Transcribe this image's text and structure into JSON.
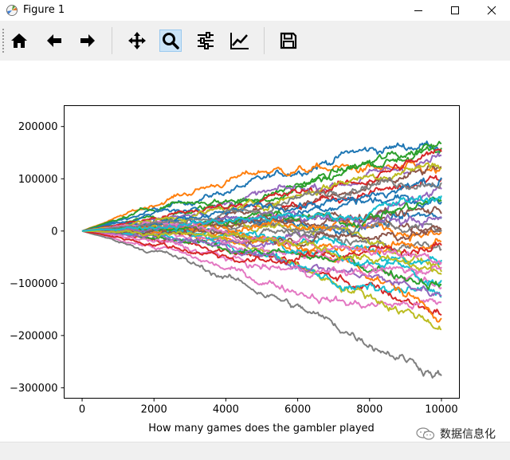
{
  "window": {
    "title": "Figure 1",
    "app_icon": "matplotlib-icon",
    "controls": [
      "minimize-icon",
      "maximize-icon",
      "close-icon"
    ]
  },
  "toolbar": {
    "buttons": [
      {
        "name": "home",
        "icon": "home-icon"
      },
      {
        "name": "back",
        "icon": "arrow-left-icon"
      },
      {
        "name": "forward",
        "icon": "arrow-right-icon"
      },
      {
        "name": "pan",
        "icon": "move-icon"
      },
      {
        "name": "zoom",
        "icon": "magnifier-icon",
        "active": true
      },
      {
        "name": "subplots",
        "icon": "sliders-icon"
      },
      {
        "name": "edit-axes",
        "icon": "line-chart-icon"
      },
      {
        "name": "save",
        "icon": "save-icon"
      }
    ]
  },
  "chart_data": {
    "type": "line",
    "title": "",
    "xlabel": "How many games does the gambler played",
    "ylabel": "",
    "xlim": [
      -500,
      10500
    ],
    "ylim": [
      -320000,
      240000
    ],
    "xticks": [
      "0",
      "2000",
      "4000",
      "6000",
      "8000",
      "10000"
    ],
    "yticks": [
      "200000",
      "100000",
      "0",
      "−100000",
      "−200000",
      "−300000"
    ],
    "xtick_values": [
      0,
      2000,
      4000,
      6000,
      8000,
      10000
    ],
    "ytick_values": [
      200000,
      100000,
      0,
      -100000,
      -200000,
      -300000
    ],
    "n_points": 10001,
    "grid": false,
    "legend": "none",
    "colors": [
      "#1f77b4",
      "#ff7f0e",
      "#2ca02c",
      "#d62728",
      "#9467bd",
      "#8c564b",
      "#e377c2",
      "#7f7f7f",
      "#bcbd22",
      "#17becf"
    ],
    "series": [
      {
        "values": [
          0,
          48000,
          95000,
          150000,
          170000
        ]
      },
      {
        "values": [
          0,
          64000,
          115000,
          120000,
          110000
        ]
      },
      {
        "values": [
          0,
          30000,
          66000,
          120000,
          167000
        ]
      },
      {
        "values": [
          0,
          -18000,
          -45000,
          -100000,
          -155000
        ]
      },
      {
        "values": [
          0,
          27000,
          70000,
          96000,
          140000
        ]
      },
      {
        "values": [
          0,
          6000,
          45000,
          70000,
          120000
        ]
      },
      {
        "values": [
          0,
          -38000,
          -95000,
          -140000,
          -140000
        ]
      },
      {
        "values": [
          0,
          -48000,
          -115000,
          -195000,
          -275000
        ]
      },
      {
        "values": [
          0,
          16000,
          -38000,
          -110000,
          -180000
        ]
      },
      {
        "values": [
          0,
          -10000,
          -40000,
          -110000,
          -120000
        ]
      },
      {
        "values": [
          0,
          20000,
          18000,
          5000,
          30000
        ]
      },
      {
        "values": [
          0,
          -5000,
          -20000,
          -60000,
          -160000
        ]
      },
      {
        "values": [
          0,
          55000,
          60000,
          120000,
          160000
        ]
      },
      {
        "values": [
          0,
          8000,
          35000,
          70000,
          90000
        ]
      },
      {
        "values": [
          0,
          -15000,
          -30000,
          20000,
          80000
        ]
      },
      {
        "values": [
          0,
          12000,
          16000,
          20000,
          10000
        ]
      },
      {
        "values": [
          0,
          -5000,
          -35000,
          -60000,
          -100000
        ]
      },
      {
        "values": [
          0,
          0,
          15000,
          -22000,
          -35000
        ]
      },
      {
        "values": [
          0,
          10000,
          10000,
          0,
          -70000
        ]
      },
      {
        "values": [
          0,
          5000,
          -10000,
          -25000,
          -100000
        ]
      },
      {
        "values": [
          0,
          40000,
          20000,
          60000,
          100000
        ]
      },
      {
        "values": [
          0,
          4000,
          17000,
          15000,
          -10000
        ]
      },
      {
        "values": [
          0,
          -20000,
          -40000,
          -60000,
          -100000
        ]
      },
      {
        "values": [
          0,
          30000,
          60000,
          90000,
          150000
        ]
      },
      {
        "values": [
          0,
          -10000,
          -50000,
          -80000,
          -120000
        ]
      },
      {
        "values": [
          0,
          2000,
          20000,
          30000,
          40000
        ]
      },
      {
        "values": [
          0,
          -25000,
          -70000,
          -80000,
          -70000
        ]
      },
      {
        "values": [
          0,
          10000,
          -5000,
          10000,
          5000
        ]
      },
      {
        "values": [
          0,
          25000,
          50000,
          100000,
          130000
        ]
      },
      {
        "values": [
          0,
          -5000,
          -10000,
          -50000,
          -60000
        ]
      },
      {
        "values": [
          0,
          15000,
          45000,
          55000,
          60000
        ]
      },
      {
        "values": [
          0,
          8000,
          -15000,
          -40000,
          -20000
        ]
      },
      {
        "values": [
          0,
          8000,
          30000,
          20000,
          60000
        ]
      },
      {
        "values": [
          0,
          -30000,
          -60000,
          -40000,
          -30000
        ]
      },
      {
        "values": [
          0,
          5000,
          30000,
          20000,
          20000
        ]
      },
      {
        "values": [
          0,
          -2000,
          -15000,
          -10000,
          0
        ]
      },
      {
        "values": [
          0,
          20000,
          -20000,
          -30000,
          -50000
        ]
      },
      {
        "values": [
          0,
          18000,
          40000,
          90000,
          100000
        ]
      },
      {
        "values": [
          0,
          -4000,
          -20000,
          -45000,
          -80000
        ]
      },
      {
        "values": [
          0,
          12000,
          25000,
          30000,
          70000
        ]
      }
    ]
  },
  "watermark": {
    "text": "数据信息化",
    "icon": "wechat-icon"
  }
}
